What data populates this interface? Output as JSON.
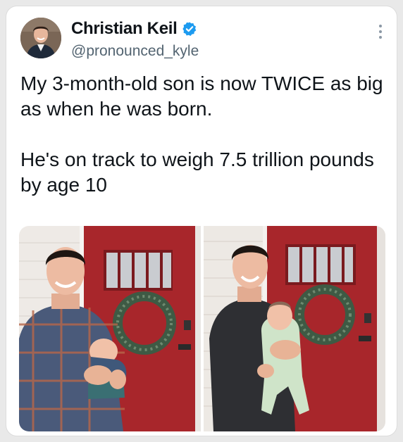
{
  "tweet": {
    "author_name": "Christian Keil",
    "handle": "@pronounced_kyle",
    "verified": true,
    "paragraphs": [
      "My 3-month-old son is now TWICE as big as when he was born.",
      "He's on track to weigh 7.5 trillion pounds by age 10"
    ]
  },
  "icons": {
    "verified": "verified-badge-icon",
    "more": "more-options-icon"
  },
  "colors": {
    "verified_blue": "#1d9bf0",
    "door_red": "#a8262b",
    "text": "#0f1419",
    "secondary_text": "#536471"
  }
}
